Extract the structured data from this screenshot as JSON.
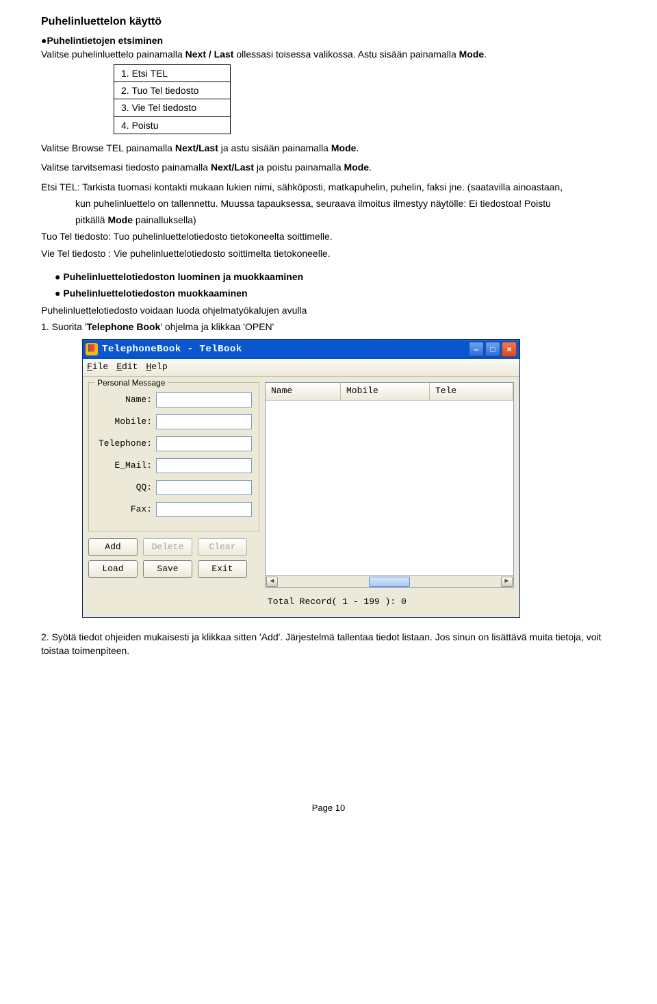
{
  "heading": "Puhelinluettelon käyttö",
  "subhead_bullet": "●Puhelintietojen etsiminen",
  "intro": {
    "pre": "Valitse puhelinluettelo painamalla ",
    "b1": "Next / Last",
    "mid": " ollessasi toisessa valikossa. Astu sisään painamalla ",
    "b2": "Mode",
    "post": "."
  },
  "menu_items": [
    "1. Etsi TEL",
    "2. Tuo Tel tiedosto",
    "3. Vie Tel tiedosto",
    "4. Poistu"
  ],
  "p2": {
    "pre": "Valitse Browse TEL painamalla ",
    "b1": "Next/Last",
    "mid": " ja astu sisään painamalla ",
    "b2": "Mode",
    "post": "."
  },
  "p3": {
    "pre": "Valitse tarvitsemasi tiedosto painamalla ",
    "b1": "Next/Last",
    "mid": " ja poistu painamalla ",
    "b2": "Mode",
    "post": "."
  },
  "p4_pre": "Etsi TEL: Tarkista tuomasi kontakti mukaan lukien nimi, sähköposti, matkapuhelin, puhelin, faksi jne. (saatavilla ainoastaan,",
  "p4_line2": "kun puhelinluettelo on tallennettu. Muussa tapauksessa, seuraava ilmoitus ilmestyy näytölle: Ei tiedostoa! Poistu",
  "p4_line3_pre": "pitkällä ",
  "p4_line3_b": "Mode",
  "p4_line3_post": " painalluksella)",
  "p5": "Tuo Tel tiedosto: Tuo puhelinluettelotiedosto tietokoneelta soittimelle.",
  "p6": "Vie Tel tiedosto : Vie puhelinluettelotiedosto soittimelta tietokoneelle.",
  "bul1": "Puhelinluettelotiedoston luominen ja muokkaaminen",
  "bul2": "Puhelinluettelotiedoston muokkaaminen",
  "p7": "Puhelinluettelotiedosto voidaan luoda ohjelmatyökalujen avulla",
  "p8_pre": "1. Suorita '",
  "p8_b": "Telephone Book",
  "p8_post": "' ohjelma ja klikkaa 'OPEN'",
  "app": {
    "title": "TelephoneBook - TelBook",
    "menus": {
      "file": "File",
      "edit": "Edit",
      "help": "Help"
    },
    "group": "Personal Message",
    "fields": {
      "name": "Name:",
      "mobile": "Mobile:",
      "telephone": "Telephone:",
      "email": "E_Mail:",
      "qq": "QQ:",
      "fax": "Fax:"
    },
    "buttons": {
      "add": "Add",
      "delete": "Delete",
      "clear": "Clear",
      "load": "Load",
      "save": "Save",
      "exit": "Exit"
    },
    "columns": {
      "name": "Name",
      "mobile": "Mobile",
      "tele": "Tele"
    },
    "total_pre": "Total Record( 1 - 199 ):   ",
    "total_val": "0"
  },
  "p9": "2. Syötä tiedot ohjeiden mukaisesti ja klikkaa sitten 'Add'. Järjestelmä tallentaa tiedot listaan. Jos sinun on lisättävä muita tietoja, voit toistaa toimenpiteen.",
  "page_footer": "Page 10"
}
